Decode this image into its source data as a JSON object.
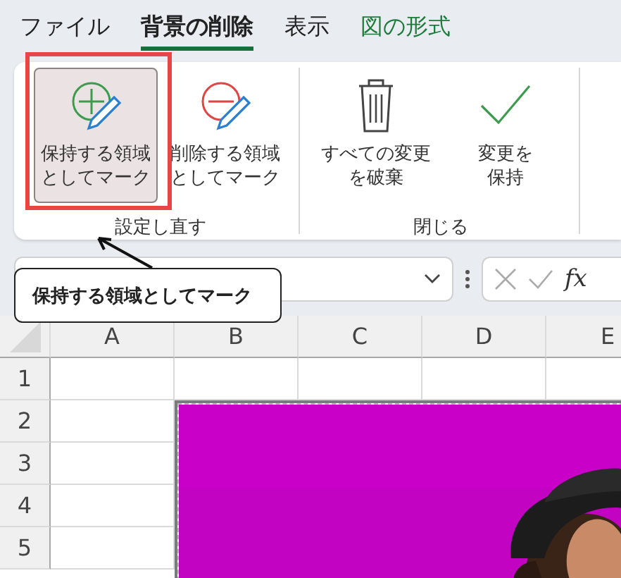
{
  "tabs": [
    {
      "label": "ファイル",
      "selected": false,
      "kind": "plain"
    },
    {
      "label": "背景の削除",
      "selected": true,
      "kind": "plain"
    },
    {
      "label": "表示",
      "selected": false,
      "kind": "plain"
    },
    {
      "label": "図の形式",
      "selected": false,
      "kind": "contextual"
    }
  ],
  "ribbon_groups": [
    {
      "label": "設定し直す",
      "buttons": [
        {
          "label": [
            "保持する領域",
            "としてマーク"
          ],
          "kind": "plus-pencil",
          "selected": true
        },
        {
          "label": [
            "削除する領域",
            "としてマーク"
          ],
          "kind": "minus-pencil",
          "selected": false
        }
      ]
    },
    {
      "label": "閉じる",
      "buttons": [
        {
          "label": [
            "すべての変更",
            "を破棄"
          ],
          "kind": "trash",
          "selected": false
        },
        {
          "label": [
            "変更を",
            "保持"
          ],
          "kind": "check",
          "selected": false
        }
      ]
    }
  ],
  "formula_bar": {
    "function_label": "fx"
  },
  "columns": [
    "A",
    "B",
    "C",
    "D",
    "E"
  ],
  "rows": [
    "1",
    "2",
    "3",
    "4",
    "5"
  ],
  "tooltip": "保持する領域としてマーク"
}
